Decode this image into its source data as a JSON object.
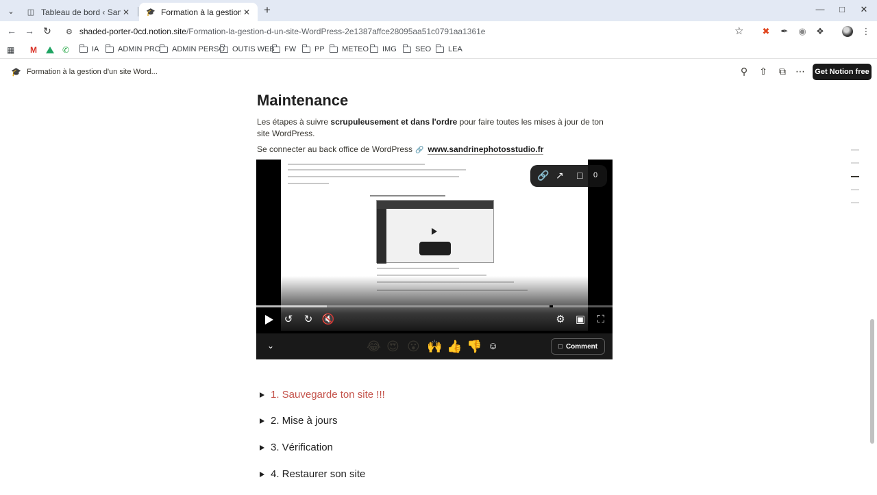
{
  "browser": {
    "tabs": [
      {
        "title": "Tableau de bord ‹ Sandrine photos",
        "active": false
      },
      {
        "title": "Formation à la gestion d'un site",
        "active": true
      }
    ],
    "url_host": "shaded-porter-0cd.notion.site",
    "url_path": "/Formation-la-gestion-d-un-site-WordPress-2e1387affce28095aa51c0791aa1361e",
    "bookmarks": [
      "IA",
      "ADMIN PRO",
      "ADMIN PERSO",
      "OUTIS WEB",
      "FW",
      "PP",
      "METEO",
      "IMG",
      "SEO",
      "LEA"
    ]
  },
  "notion": {
    "breadcrumb_title": "Formation à la gestion d'un site Word...",
    "get_notion_label": "Get Notion free"
  },
  "page": {
    "heading": "Maintenance",
    "intro_before": "Les étapes à suivre ",
    "intro_bold": "scrupuleusement et dans l'ordre",
    "intro_after": " pour faire toutes les mises à jour de ton site WordPress.",
    "login_text": "Se connecter au back office de WordPress",
    "login_url": "www.sandrinephotosstudio.fr",
    "video": {
      "comment_count": "0",
      "comment_label": "Comment",
      "reactions": [
        "😂",
        "😍",
        "😮",
        "🙌",
        "👍",
        "👎"
      ]
    },
    "toggles": [
      "1. Sauvegarde ton site !!!",
      "2. Mise à jours",
      "3. Vérification",
      "4. Restaurer son site"
    ]
  },
  "colors": {
    "toggle_highlight": "#c4524a",
    "tab_strip": "#e3e9f4",
    "video_bar": "#191919"
  }
}
